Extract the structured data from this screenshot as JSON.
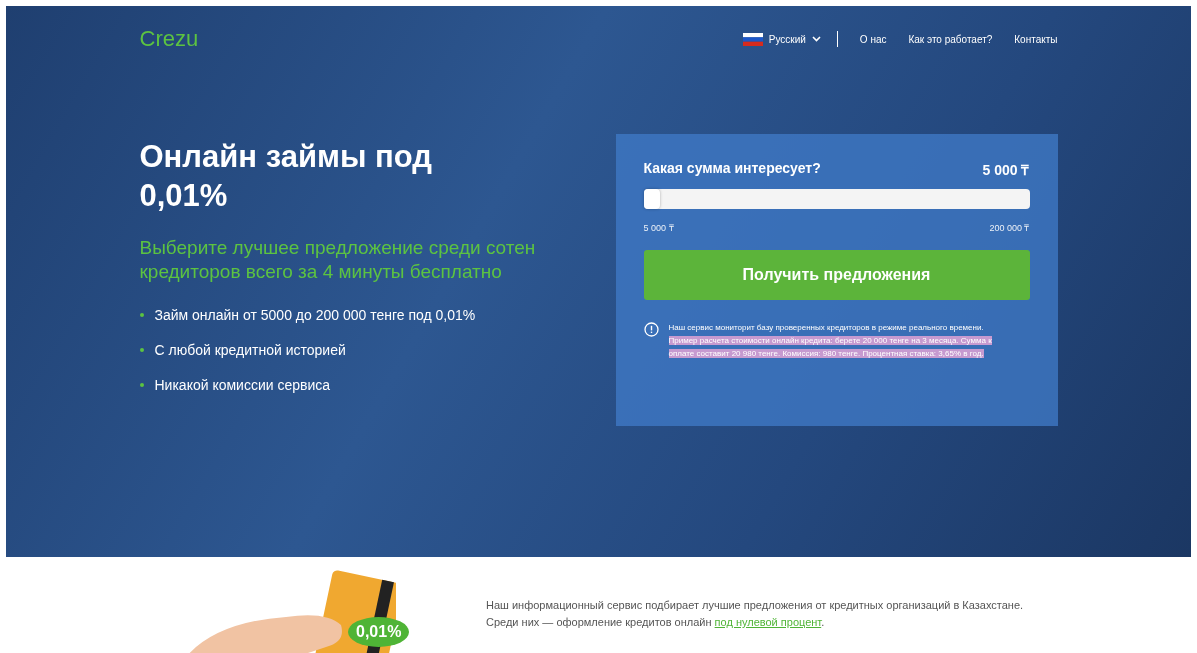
{
  "header": {
    "logo": "Crezu",
    "language": {
      "label": "Русский"
    },
    "nav": [
      "О нас",
      "Как это работает?",
      "Контакты"
    ]
  },
  "hero": {
    "title": "Онлайн займы под 0,01%",
    "subtitle": "Выберите лучшее предложение среди сотен кредиторов всего за 4 минуты бесплатно",
    "bullets": [
      "Займ онлайн от 5000 до 200 000 тенге под 0,01%",
      "С любой кредитной историей",
      "Никакой комиссии сервиса"
    ]
  },
  "calculator": {
    "question": "Какая сумма интересует?",
    "amount": "5 000 ₸",
    "slider": {
      "level": 0,
      "min_label": "5 000 ₸",
      "max_label": "200 000 ₸"
    },
    "button": "Получить предложения",
    "info": "Наш сервис мониторит базу проверенных кредиторов в режиме реального времени.",
    "example": {
      "text": "Пример расчета стоимости онлайн кредита: берете 20 000 тенге на 3 месяца. Сумма к оплате составит 20 980 тенге. Комиссия: 980 тенге. Процентная ставка: 3,65% в год.",
      "selected": true
    }
  },
  "about": {
    "badge": "0,01%",
    "text": "Наш информационный сервис подбирает лучшие предложения от кредитных организаций в Казахстане. Среди них — оформление кредитов онлайн",
    "link": "под нулевой процент",
    "after_link": "."
  }
}
